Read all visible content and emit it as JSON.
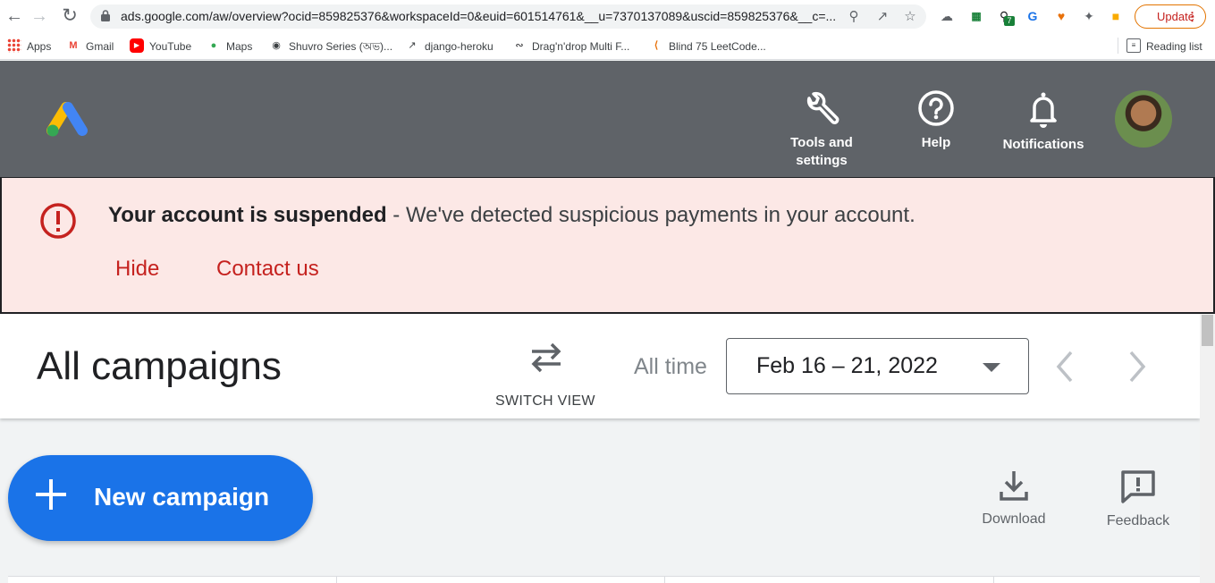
{
  "browser": {
    "url": "ads.google.com/aw/overview?ocid=859825376&workspaceId=0&euid=601514761&__u=7370137089&uscid=859825376&__c=...",
    "update_label": "Update",
    "extension_badge": "7"
  },
  "bookmarks": {
    "items": [
      {
        "label": "Apps",
        "icon": "apps-grid-icon"
      },
      {
        "label": "Gmail",
        "icon": "gmail-icon"
      },
      {
        "label": "YouTube",
        "icon": "youtube-icon"
      },
      {
        "label": "Maps",
        "icon": "maps-icon"
      },
      {
        "label": "Shuvro Series (অভ)...",
        "icon": "globe-icon"
      },
      {
        "label": "django-heroku",
        "icon": "chart-line-icon"
      },
      {
        "label": "Drag'n'drop Multi F...",
        "icon": "swirl-icon"
      },
      {
        "label": "Blind 75 LeetCode...",
        "icon": "leetcode-icon"
      }
    ],
    "reading_list": "Reading list"
  },
  "header": {
    "tools_label_line1": "Tools and",
    "tools_label_line2": "settings",
    "help_label": "Help",
    "notifications_label": "Notifications"
  },
  "banner": {
    "title": "Your account is suspended",
    "message": " - We've detected suspicious payments in your account.",
    "hide_label": "Hide",
    "contact_label": "Contact us"
  },
  "toolbar": {
    "page_title": "All campaigns",
    "switch_view_label": "SWITCH VIEW",
    "range_label": "All time",
    "date_range": "Feb 16 – 21, 2022"
  },
  "main": {
    "new_campaign_label": "New campaign",
    "download_label": "Download",
    "feedback_label": "Feedback"
  },
  "colors": {
    "header_bg": "#5f6368",
    "banner_bg": "#fce8e6",
    "error_red": "#c5221f",
    "primary_blue": "#1a73e8"
  }
}
